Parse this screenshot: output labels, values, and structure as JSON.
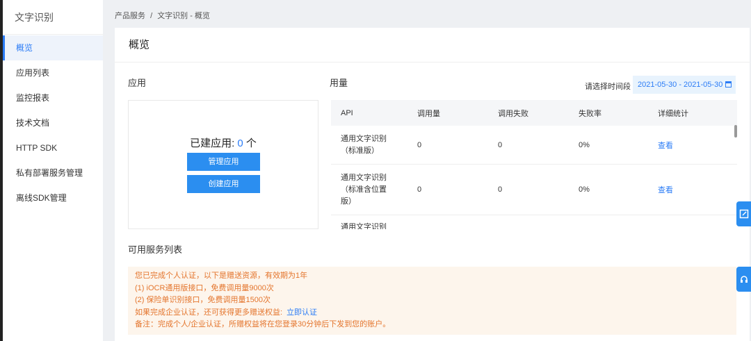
{
  "sidebar": {
    "title": "文字识别",
    "items": [
      {
        "label": "概览"
      },
      {
        "label": "应用列表"
      },
      {
        "label": "监控报表"
      },
      {
        "label": "技术文档"
      },
      {
        "label": "HTTP SDK"
      },
      {
        "label": "私有部署服务管理"
      },
      {
        "label": "离线SDK管理"
      }
    ]
  },
  "breadcrumb": {
    "root": "产品服务",
    "sep": "/",
    "current": "文字识别 - 概览"
  },
  "page_title": "概览",
  "apps": {
    "title": "应用",
    "count_prefix": "已建应用: ",
    "count": "0",
    "count_suffix": " 个",
    "manage_button": "管理应用",
    "create_button": "创建应用"
  },
  "usage": {
    "title": "用量",
    "date_label": "请选择时间段",
    "date_range": "2021-05-30 - 2021-05-30",
    "columns": [
      "API",
      "调用量",
      "调用失败",
      "失败率",
      "详细统计"
    ],
    "rows": [
      {
        "api_line1": "通用文字识别",
        "api_line2": "（标准版）",
        "api_line3": "",
        "calls": "0",
        "failed": "0",
        "rate": "0%",
        "detail": "查看"
      },
      {
        "api_line1": "通用文字识别",
        "api_line2": "（标准含位置",
        "api_line3": "版）",
        "calls": "0",
        "failed": "0",
        "rate": "0%",
        "detail": "查看"
      },
      {
        "api_line1": "通用文字识别",
        "api_line2": "",
        "api_line3": "",
        "calls": "",
        "failed": "",
        "rate": "",
        "detail": ""
      }
    ]
  },
  "services": {
    "title": "可用服务列表",
    "notice_line1": "您已完成个人认证，以下是赠送资源，有效期为1年",
    "notice_line2": "(1) iOCR通用版接口，免费调用量9000次",
    "notice_line3": "(2) 保险单识别接口，免费调用量1500次",
    "notice_line4": "如果完成企业认证，还可获得更多赠送权益:",
    "notice_link": "立即认证",
    "notice_line5": "备注：完成个人/企业认证，所赠权益将在您登录30分钟后下发到您的账户。"
  },
  "colors": {
    "accent": "#2b7cf6",
    "button": "#2b8ef0",
    "notice_text": "#e4752d",
    "notice_bg": "#fdf5ec"
  },
  "icons": {
    "date": "calendar-icon",
    "tab1": "edit-icon",
    "tab2": "headset-icon"
  }
}
